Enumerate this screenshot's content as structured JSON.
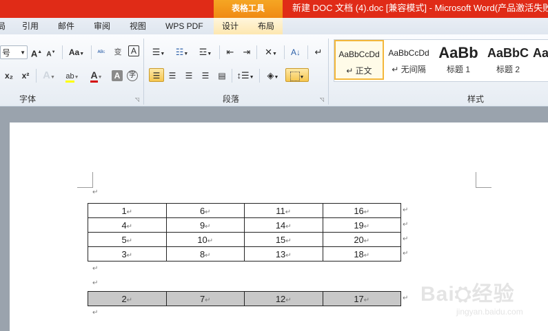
{
  "titlebar": {
    "context_group": "表格工具",
    "document_title": "新建 DOC 文档 (4).doc [兼容模式] - Microsoft Word(产品激活失败"
  },
  "tabs": [
    "局",
    "引用",
    "邮件",
    "审阅",
    "视图",
    "WPS PDF",
    "设计",
    "布局"
  ],
  "font_group": {
    "font_size": "号",
    "label": "字体",
    "grow_label": "A",
    "shrink_label": "A",
    "case_label": "Aa"
  },
  "paragraph_group": {
    "label": "段落"
  },
  "styles_group": {
    "label": "样式",
    "items": [
      {
        "sample": "AaBbCcDd",
        "name": "↵ 正文"
      },
      {
        "sample": "AaBbCcDd",
        "name": "↵ 无间隔"
      },
      {
        "sample": "AaBb",
        "name": "标题 1"
      },
      {
        "sample": "AaBbC",
        "name": "标题 2"
      },
      {
        "sample": "Aa",
        "name": ""
      }
    ]
  },
  "colors": {
    "title_red": "#e02b17",
    "context_orange": "#f39c12",
    "font_color_red": "#d40000",
    "highlight_yellow": "#ffff00",
    "selection_gray": "#c8c8c8"
  },
  "document": {
    "paragraph_mark": "↵",
    "cell_mark": "↵",
    "table1": [
      [
        "1",
        "6",
        "11",
        "16"
      ],
      [
        "4",
        "9",
        "14",
        "19"
      ],
      [
        "5",
        "10",
        "15",
        "20"
      ],
      [
        "3",
        "8",
        "13",
        "18"
      ]
    ],
    "table2": [
      [
        "2",
        "7",
        "12",
        "17"
      ]
    ]
  },
  "watermark": {
    "logo_text": "Bai⛭经验",
    "url": "jingyan.baidu.com"
  }
}
